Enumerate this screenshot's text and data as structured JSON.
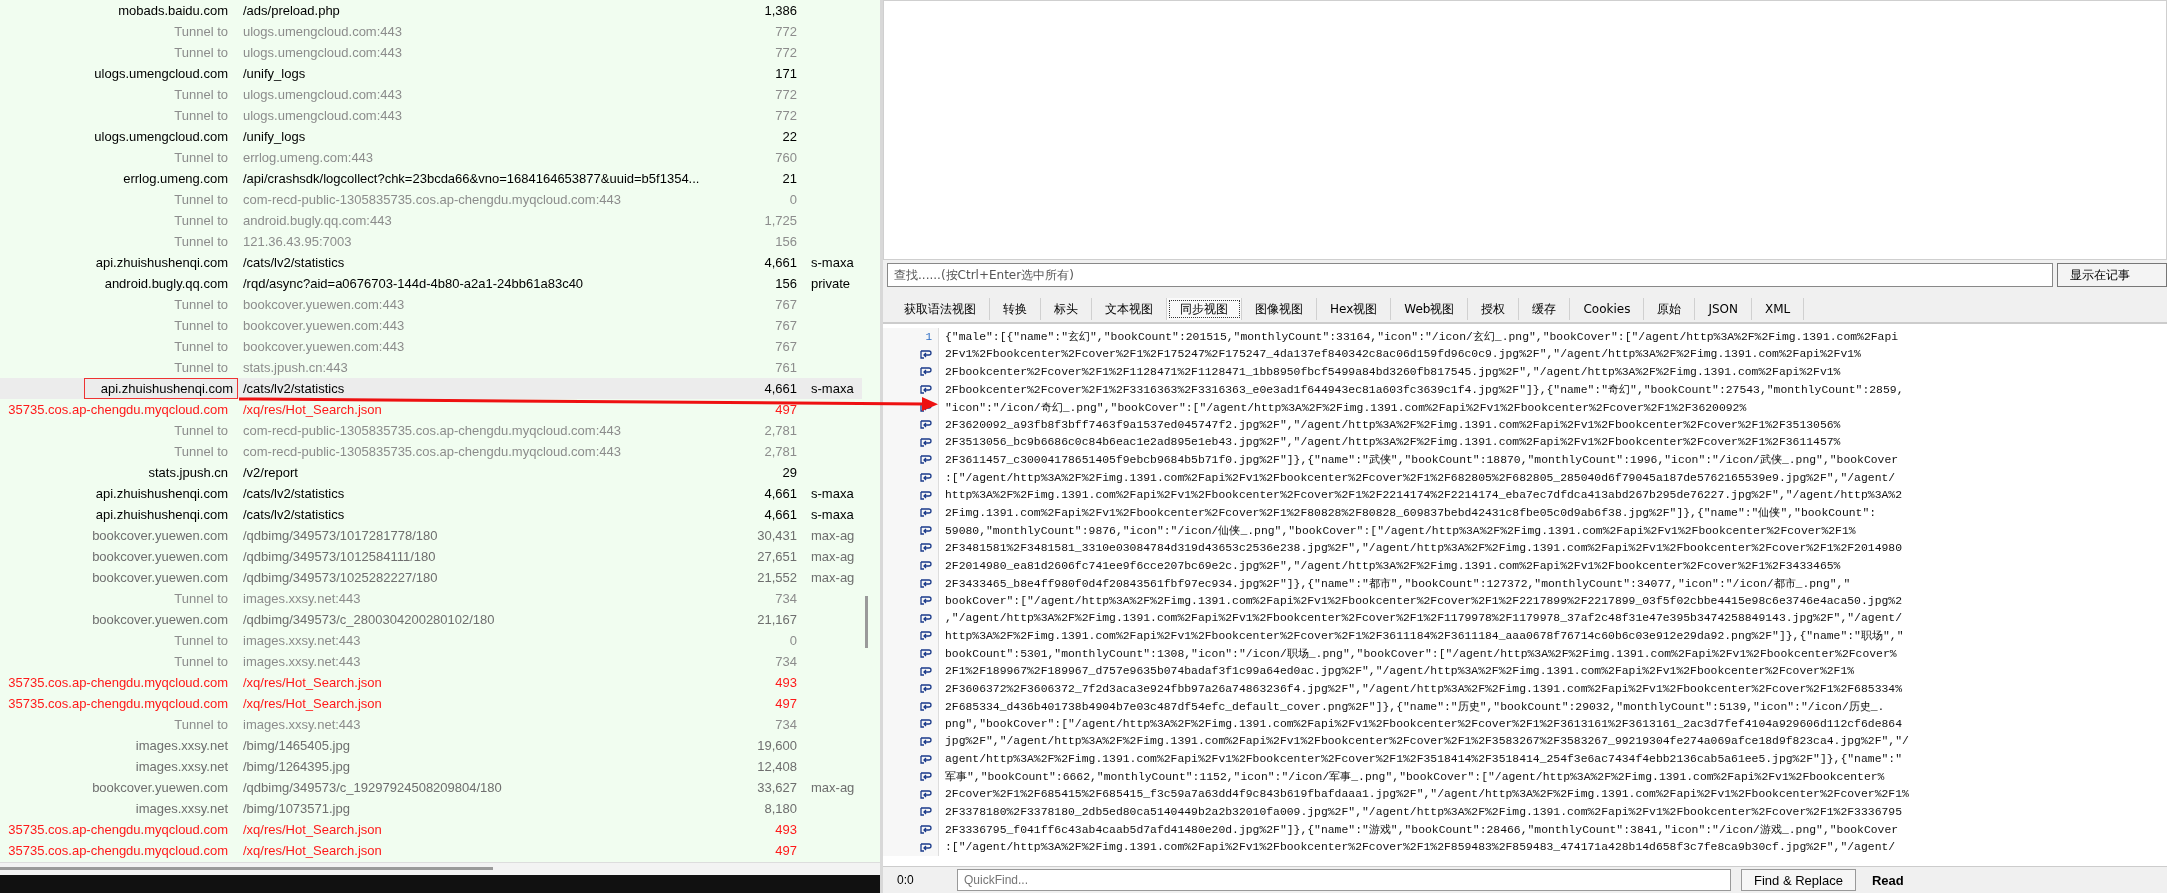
{
  "sessions": {
    "rows": [
      {
        "kind": "request",
        "host": "mobads.baidu.com",
        "url": "/ads/preload.php",
        "size": "1,386",
        "caching": "",
        "selected": false
      },
      {
        "kind": "tunnel",
        "host": "Tunnel to",
        "url": "ulogs.umengcloud.com:443",
        "size": "772",
        "caching": "",
        "selected": false
      },
      {
        "kind": "tunnel",
        "host": "Tunnel to",
        "url": "ulogs.umengcloud.com:443",
        "size": "772",
        "caching": "",
        "selected": false
      },
      {
        "kind": "request",
        "host": "ulogs.umengcloud.com",
        "url": "/unify_logs",
        "size": "171",
        "caching": "",
        "selected": false
      },
      {
        "kind": "tunnel",
        "host": "Tunnel to",
        "url": "ulogs.umengcloud.com:443",
        "size": "772",
        "caching": "",
        "selected": false
      },
      {
        "kind": "tunnel",
        "host": "Tunnel to",
        "url": "ulogs.umengcloud.com:443",
        "size": "772",
        "caching": "",
        "selected": false
      },
      {
        "kind": "request",
        "host": "ulogs.umengcloud.com",
        "url": "/unify_logs",
        "size": "22",
        "caching": "",
        "selected": false
      },
      {
        "kind": "tunnel",
        "host": "Tunnel to",
        "url": "errlog.umeng.com:443",
        "size": "760",
        "caching": "",
        "selected": false
      },
      {
        "kind": "request",
        "host": "errlog.umeng.com",
        "url": "/api/crashsdk/logcollect?chk=23bcda66&vno=1684164653877&uuid=b5f1354...",
        "size": "21",
        "caching": "",
        "selected": false
      },
      {
        "kind": "tunnel",
        "host": "Tunnel to",
        "url": "com-recd-public-1305835735.cos.ap-chengdu.myqcloud.com:443",
        "size": "0",
        "caching": "",
        "selected": false
      },
      {
        "kind": "tunnel",
        "host": "Tunnel to",
        "url": "android.bugly.qq.com:443",
        "size": "1,725",
        "caching": "",
        "selected": false
      },
      {
        "kind": "tunnel",
        "host": "Tunnel to",
        "url": "121.36.43.95:7003",
        "size": "156",
        "caching": "",
        "selected": false
      },
      {
        "kind": "request",
        "host": "api.zhuishushenqi.com",
        "url": "/cats/lv2/statistics",
        "size": "4,661",
        "caching": "s-maxa",
        "selected": false
      },
      {
        "kind": "request",
        "host": "android.bugly.qq.com",
        "url": "/rqd/async?aid=a0676703-144d-4b80-a2a1-24bb61a83c40",
        "size": "156",
        "caching": "private",
        "selected": false
      },
      {
        "kind": "tunnel",
        "host": "Tunnel to",
        "url": "bookcover.yuewen.com:443",
        "size": "767",
        "caching": "",
        "selected": false
      },
      {
        "kind": "tunnel",
        "host": "Tunnel to",
        "url": "bookcover.yuewen.com:443",
        "size": "767",
        "caching": "",
        "selected": false
      },
      {
        "kind": "tunnel",
        "host": "Tunnel to",
        "url": "bookcover.yuewen.com:443",
        "size": "767",
        "caching": "",
        "selected": false
      },
      {
        "kind": "tunnel",
        "host": "Tunnel to",
        "url": "stats.jpush.cn:443",
        "size": "761",
        "caching": "",
        "selected": false
      },
      {
        "kind": "request",
        "host": "api.zhuishushenqi.com",
        "url": "/cats/lv2/statistics",
        "size": "4,661",
        "caching": "s-maxa",
        "selected": true
      },
      {
        "kind": "error",
        "host": "35735.cos.ap-chengdu.myqcloud.com",
        "url": "/xq/res/Hot_Search.json",
        "size": "497",
        "caching": "",
        "selected": false
      },
      {
        "kind": "tunnel",
        "host": "Tunnel to",
        "url": "com-recd-public-1305835735.cos.ap-chengdu.myqcloud.com:443",
        "size": "2,781",
        "caching": "",
        "selected": false
      },
      {
        "kind": "tunnel",
        "host": "Tunnel to",
        "url": "com-recd-public-1305835735.cos.ap-chengdu.myqcloud.com:443",
        "size": "2,781",
        "caching": "",
        "selected": false
      },
      {
        "kind": "request",
        "host": "stats.jpush.cn",
        "url": "/v2/report",
        "size": "29",
        "caching": "",
        "selected": false
      },
      {
        "kind": "request",
        "host": "api.zhuishushenqi.com",
        "url": "/cats/lv2/statistics",
        "size": "4,661",
        "caching": "s-maxa",
        "selected": false
      },
      {
        "kind": "request",
        "host": "api.zhuishushenqi.com",
        "url": "/cats/lv2/statistics",
        "size": "4,661",
        "caching": "s-maxa",
        "selected": false
      },
      {
        "kind": "image",
        "host": "bookcover.yuewen.com",
        "url": "/qdbimg/349573/1017281778/180",
        "size": "30,431",
        "caching": "max-ag",
        "selected": false
      },
      {
        "kind": "image",
        "host": "bookcover.yuewen.com",
        "url": "/qdbimg/349573/1012584111/180",
        "size": "27,651",
        "caching": "max-ag",
        "selected": false
      },
      {
        "kind": "image",
        "host": "bookcover.yuewen.com",
        "url": "/qdbimg/349573/1025282227/180",
        "size": "21,552",
        "caching": "max-ag",
        "selected": false
      },
      {
        "kind": "tunnel",
        "host": "Tunnel to",
        "url": "images.xxsy.net:443",
        "size": "734",
        "caching": "",
        "selected": false
      },
      {
        "kind": "image",
        "host": "bookcover.yuewen.com",
        "url": "/qdbimg/349573/c_2800304200280102/180",
        "size": "21,167",
        "caching": "",
        "selected": false
      },
      {
        "kind": "tunnel",
        "host": "Tunnel to",
        "url": "images.xxsy.net:443",
        "size": "0",
        "caching": "",
        "selected": false
      },
      {
        "kind": "tunnel",
        "host": "Tunnel to",
        "url": "images.xxsy.net:443",
        "size": "734",
        "caching": "",
        "selected": false
      },
      {
        "kind": "error",
        "host": "35735.cos.ap-chengdu.myqcloud.com",
        "url": "/xq/res/Hot_Search.json",
        "size": "493",
        "caching": "",
        "selected": false
      },
      {
        "kind": "error",
        "host": "35735.cos.ap-chengdu.myqcloud.com",
        "url": "/xq/res/Hot_Search.json",
        "size": "497",
        "caching": "",
        "selected": false
      },
      {
        "kind": "tunnel",
        "host": "Tunnel to",
        "url": "images.xxsy.net:443",
        "size": "734",
        "caching": "",
        "selected": false
      },
      {
        "kind": "image",
        "host": "images.xxsy.net",
        "url": "/bimg/1465405.jpg",
        "size": "19,600",
        "caching": "",
        "selected": false
      },
      {
        "kind": "image",
        "host": "images.xxsy.net",
        "url": "/bimg/1264395.jpg",
        "size": "12,408",
        "caching": "",
        "selected": false
      },
      {
        "kind": "image",
        "host": "bookcover.yuewen.com",
        "url": "/qdbimg/349573/c_19297924508209804/180",
        "size": "33,627",
        "caching": "max-ag",
        "selected": false
      },
      {
        "kind": "image",
        "host": "images.xxsy.net",
        "url": "/bimg/1073571.jpg",
        "size": "8,180",
        "caching": "",
        "selected": false
      },
      {
        "kind": "error",
        "host": "35735.cos.ap-chengdu.myqcloud.com",
        "url": "/xq/res/Hot_Search.json",
        "size": "493",
        "caching": "",
        "selected": false
      },
      {
        "kind": "error",
        "host": "35735.cos.ap-chengdu.myqcloud.com",
        "url": "/xq/res/Hot_Search.json",
        "size": "497",
        "caching": "",
        "selected": false
      }
    ]
  },
  "find_bar": {
    "placeholder": "查找......(按Ctrl+Enter选中所有)",
    "button": "显示在记事"
  },
  "tabs": [
    {
      "label": "获取语法视图",
      "selected": false
    },
    {
      "label": "转换",
      "selected": false
    },
    {
      "label": "标头",
      "selected": false
    },
    {
      "label": "文本视图",
      "selected": false
    },
    {
      "label": "同步视图",
      "selected": true
    },
    {
      "label": "图像视图",
      "selected": false
    },
    {
      "label": "Hex视图",
      "selected": false
    },
    {
      "label": "Web视图",
      "selected": false
    },
    {
      "label": "授权",
      "selected": false
    },
    {
      "label": "缓存",
      "selected": false
    },
    {
      "label": "Cookies",
      "selected": false
    },
    {
      "label": "原始",
      "selected": false
    },
    {
      "label": "JSON",
      "selected": false
    },
    {
      "label": "XML",
      "selected": false
    }
  ],
  "code": {
    "lines": [
      {
        "number": "1",
        "text": "{\"male\":[{\"name\":\"玄幻\",\"bookCount\":201515,\"monthlyCount\":33164,\"icon\":\"/icon/玄幻_.png\",\"bookCover\":[\"/agent/http%3A%2F%2Fimg.1391.com%2Fapi"
      },
      {
        "text": "2Fv1%2Fbookcenter%2Fcover%2F1%2F175247%2F175247_4da137ef840342c8ac06d159fd96c0c9.jpg%2F\",\"/agent/http%3A%2F%2Fimg.1391.com%2Fapi%2Fv1%"
      },
      {
        "text": "2Fbookcenter%2Fcover%2F1%2F1128471%2F1128471_1bb8950fbcf5499a84bd3260fb817545.jpg%2F\",\"/agent/http%3A%2F%2Fimg.1391.com%2Fapi%2Fv1%"
      },
      {
        "text": "2Fbookcenter%2Fcover%2F1%2F3316363%2F3316363_e0e3ad1f644943ec81a603fc3639c1f4.jpg%2F\"]},{\"name\":\"奇幻\",\"bookCount\":27543,\"monthlyCount\":2859,"
      },
      {
        "text": "\"icon\":\"/icon/奇幻_.png\",\"bookCover\":[\"/agent/http%3A%2F%2Fimg.1391.com%2Fapi%2Fv1%2Fbookcenter%2Fcover%2F1%2F3620092%"
      },
      {
        "text": "2F3620092_a93fb8f3bff7463f9a1537ed045747f2.jpg%2F\",\"/agent/http%3A%2F%2Fimg.1391.com%2Fapi%2Fv1%2Fbookcenter%2Fcover%2F1%2F3513056%"
      },
      {
        "text": "2F3513056_bc9b6686c0c84b6eac1e2ad895e1eb43.jpg%2F\",\"/agent/http%3A%2F%2Fimg.1391.com%2Fapi%2Fv1%2Fbookcenter%2Fcover%2F1%2F3611457%"
      },
      {
        "text": "2F3611457_c30004178651405f9ebcb9684b5b71f0.jpg%2F\"]},{\"name\":\"武侠\",\"bookCount\":18870,\"monthlyCount\":1996,\"icon\":\"/icon/武侠_.png\",\"bookCover"
      },
      {
        "text": ":[\"/agent/http%3A%2F%2Fimg.1391.com%2Fapi%2Fv1%2Fbookcenter%2Fcover%2F1%2F682805%2F682805_285040d6f79045a187de5762165539e9.jpg%2F\",\"/agent/"
      },
      {
        "text": "http%3A%2F%2Fimg.1391.com%2Fapi%2Fv1%2Fbookcenter%2Fcover%2F1%2F2214174%2F2214174_eba7ec7dfdca413abd267b295de76227.jpg%2F\",\"/agent/http%3A%2"
      },
      {
        "text": "2Fimg.1391.com%2Fapi%2Fv1%2Fbookcenter%2Fcover%2F1%2F80828%2F80828_609837bebd42431c8fbe05c0d9ab6f38.jpg%2F\"]},{\"name\":\"仙侠\",\"bookCount\":"
      },
      {
        "text": "59080,\"monthlyCount\":9876,\"icon\":\"/icon/仙侠_.png\",\"bookCover\":[\"/agent/http%3A%2F%2Fimg.1391.com%2Fapi%2Fv1%2Fbookcenter%2Fcover%2F1%"
      },
      {
        "text": "2F3481581%2F3481581_3310e03084784d319d43653c2536e238.jpg%2F\",\"/agent/http%3A%2F%2Fimg.1391.com%2Fapi%2Fv1%2Fbookcenter%2Fcover%2F1%2F2014980"
      },
      {
        "text": "2F2014980_ea81d2606fc741ee9f6cce207bc69e2c.jpg%2F\",\"/agent/http%3A%2F%2Fimg.1391.com%2Fapi%2Fv1%2Fbookcenter%2Fcover%2F1%2F3433465%"
      },
      {
        "text": "2F3433465_b8e4ff980f0d4f20843561fbf97ec934.jpg%2F\"]},{\"name\":\"都市\",\"bookCount\":127372,\"monthlyCount\":34077,\"icon\":\"/icon/都市_.png\",\""
      },
      {
        "text": "bookCover\":[\"/agent/http%3A%2F%2Fimg.1391.com%2Fapi%2Fv1%2Fbookcenter%2Fcover%2F1%2F2217899%2F2217899_03f5f02cbbe4415e98c6e3746e4aca50.jpg%2"
      },
      {
        "text": ",\"/agent/http%3A%2F%2Fimg.1391.com%2Fapi%2Fv1%2Fbookcenter%2Fcover%2F1%2F1179978%2F1179978_37af2c48f31e47e395b3474258849143.jpg%2F\",\"/agent/"
      },
      {
        "text": "http%3A%2F%2Fimg.1391.com%2Fapi%2Fv1%2Fbookcenter%2Fcover%2F1%2F3611184%2F3611184_aaa0678f76714c60b6c03e912e29da92.png%2F\"]},{\"name\":\"职场\",\""
      },
      {
        "text": "bookCount\":5301,\"monthlyCount\":1308,\"icon\":\"/icon/职场_.png\",\"bookCover\":[\"/agent/http%3A%2F%2Fimg.1391.com%2Fapi%2Fv1%2Fbookcenter%2Fcover%"
      },
      {
        "text": "2F1%2F189967%2F189967_d757e9635b074badaf3f1c99a64ed0ac.jpg%2F\",\"/agent/http%3A%2F%2Fimg.1391.com%2Fapi%2Fv1%2Fbookcenter%2Fcover%2F1%"
      },
      {
        "text": "2F3606372%2F3606372_7f2d3aca3e924fbb97a26a74863236f4.jpg%2F\",\"/agent/http%3A%2F%2Fimg.1391.com%2Fapi%2Fv1%2Fbookcenter%2Fcover%2F1%2F685334%"
      },
      {
        "text": "2F685334_d436b401738b4904b7e03c487df54efc_default_cover.png%2F\"]},{\"name\":\"历史\",\"bookCount\":29032,\"monthlyCount\":5139,\"icon\":\"/icon/历史_."
      },
      {
        "text": "png\",\"bookCover\":[\"/agent/http%3A%2F%2Fimg.1391.com%2Fapi%2Fv1%2Fbookcenter%2Fcover%2F1%2F3613161%2F3613161_2ac3d7fef4104a929606d112cf6de864"
      },
      {
        "text": "jpg%2F\",\"/agent/http%3A%2F%2Fimg.1391.com%2Fapi%2Fv1%2Fbookcenter%2Fcover%2F1%2F3583267%2F3583267_99219304fe274a069afce18d9f823ca4.jpg%2F\",\"/"
      },
      {
        "text": "agent/http%3A%2F%2Fimg.1391.com%2Fapi%2Fv1%2Fbookcenter%2Fcover%2F1%2F3518414%2F3518414_254f3e6ac7434f4ebb2136cab5a61ee5.jpg%2F\"]},{\"name\":\""
      },
      {
        "text": "军事\",\"bookCount\":6662,\"monthlyCount\":1152,\"icon\":\"/icon/军事_.png\",\"bookCover\":[\"/agent/http%3A%2F%2Fimg.1391.com%2Fapi%2Fv1%2Fbookcenter%"
      },
      {
        "text": "2Fcover%2F1%2F685415%2F685415_f3c59a7a63dd4f9c843b619fbafdaaa1.jpg%2F\",\"/agent/http%3A%2F%2Fimg.1391.com%2Fapi%2Fv1%2Fbookcenter%2Fcover%2F1%"
      },
      {
        "text": "2F3378180%2F3378180_2db5ed80ca5140449b2a2b32010fa009.jpg%2F\",\"/agent/http%3A%2F%2Fimg.1391.com%2Fapi%2Fv1%2Fbookcenter%2Fcover%2F1%2F3336795"
      },
      {
        "text": "2F3336795_f041ff6c43ab4caab5d7afd41480e20d.jpg%2F\"]},{\"name\":\"游戏\",\"bookCount\":28466,\"monthlyCount\":3841,\"icon\":\"/icon/游戏_.png\",\"bookCover"
      },
      {
        "text": ":[\"/agent/http%3A%2F%2Fimg.1391.com%2Fapi%2Fv1%2Fbookcenter%2Fcover%2F1%2F859483%2F859483_474171a428b14d658f3c7fe8ca9b30cf.jpg%2F\",\"/agent/"
      }
    ]
  },
  "status_bar": {
    "position": "0:0",
    "quickfind_placeholder": "QuickFind...",
    "button": "Find & Replace",
    "mode": "Read"
  }
}
